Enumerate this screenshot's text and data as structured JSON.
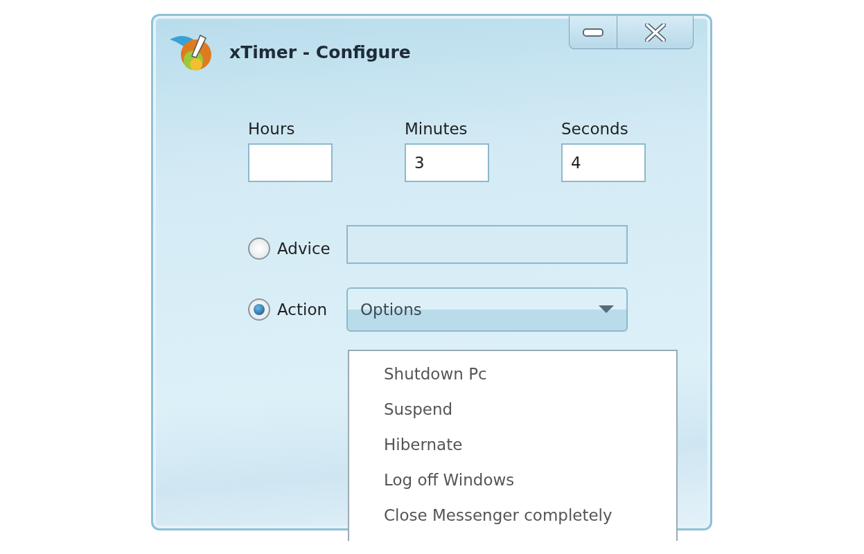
{
  "window": {
    "title": "xTimer - Configure"
  },
  "time_fields": [
    {
      "label": "Hours"
    },
    {
      "label": "Minutes",
      "value": "3"
    },
    {
      "label": "Seconds",
      "value": "4"
    }
  ],
  "modes": [
    {
      "label": "Advice",
      "selected": false,
      "kind": "text"
    },
    {
      "label": "Action",
      "selected": true,
      "kind": "combo",
      "value": "Options"
    }
  ],
  "dropdown": {
    "items": [
      "Shutdown Pc",
      "Suspend",
      "Hibernate",
      "Log off Windows",
      "Close Messenger completely"
    ]
  }
}
